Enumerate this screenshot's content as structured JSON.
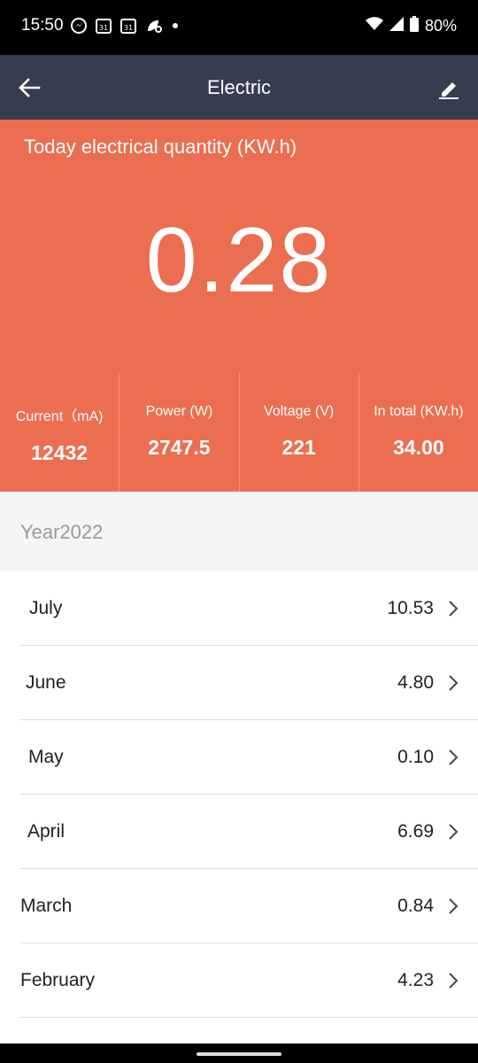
{
  "status_bar": {
    "time": "15:50",
    "battery": "80%",
    "left_icons": [
      "messenger-icon",
      "calendar-icon",
      "calendar-icon",
      "leaf-icon",
      "dot-icon"
    ],
    "right_icons": [
      "wifi-icon",
      "signal-icon",
      "battery-icon"
    ]
  },
  "app_bar": {
    "title": "Electric",
    "back_icon": "arrow-left-icon",
    "edit_icon": "pencil-icon"
  },
  "summary": {
    "label": "Today electrical quantity (KW.h)",
    "value": "0.28",
    "background": "#ec6e51",
    "stats": [
      {
        "label": "Current（mA)",
        "value": "12432"
      },
      {
        "label": "Power (W)",
        "value": "2747.5"
      },
      {
        "label": "Voltage (V)",
        "value": "221"
      },
      {
        "label": "In total (KW.h)",
        "value": "34.00"
      }
    ]
  },
  "year_header": "Year2022",
  "months": [
    {
      "name": "July",
      "value": "10.53"
    },
    {
      "name": "June",
      "value": "4.80"
    },
    {
      "name": "May",
      "value": "0.10"
    },
    {
      "name": "April",
      "value": "6.69"
    },
    {
      "name": "March",
      "value": "0.84"
    },
    {
      "name": "February",
      "value": "4.23"
    }
  ],
  "colors": {
    "app_bar": "#363d4e",
    "accent": "#ec6e51",
    "header_bg": "#f5f5f5"
  }
}
